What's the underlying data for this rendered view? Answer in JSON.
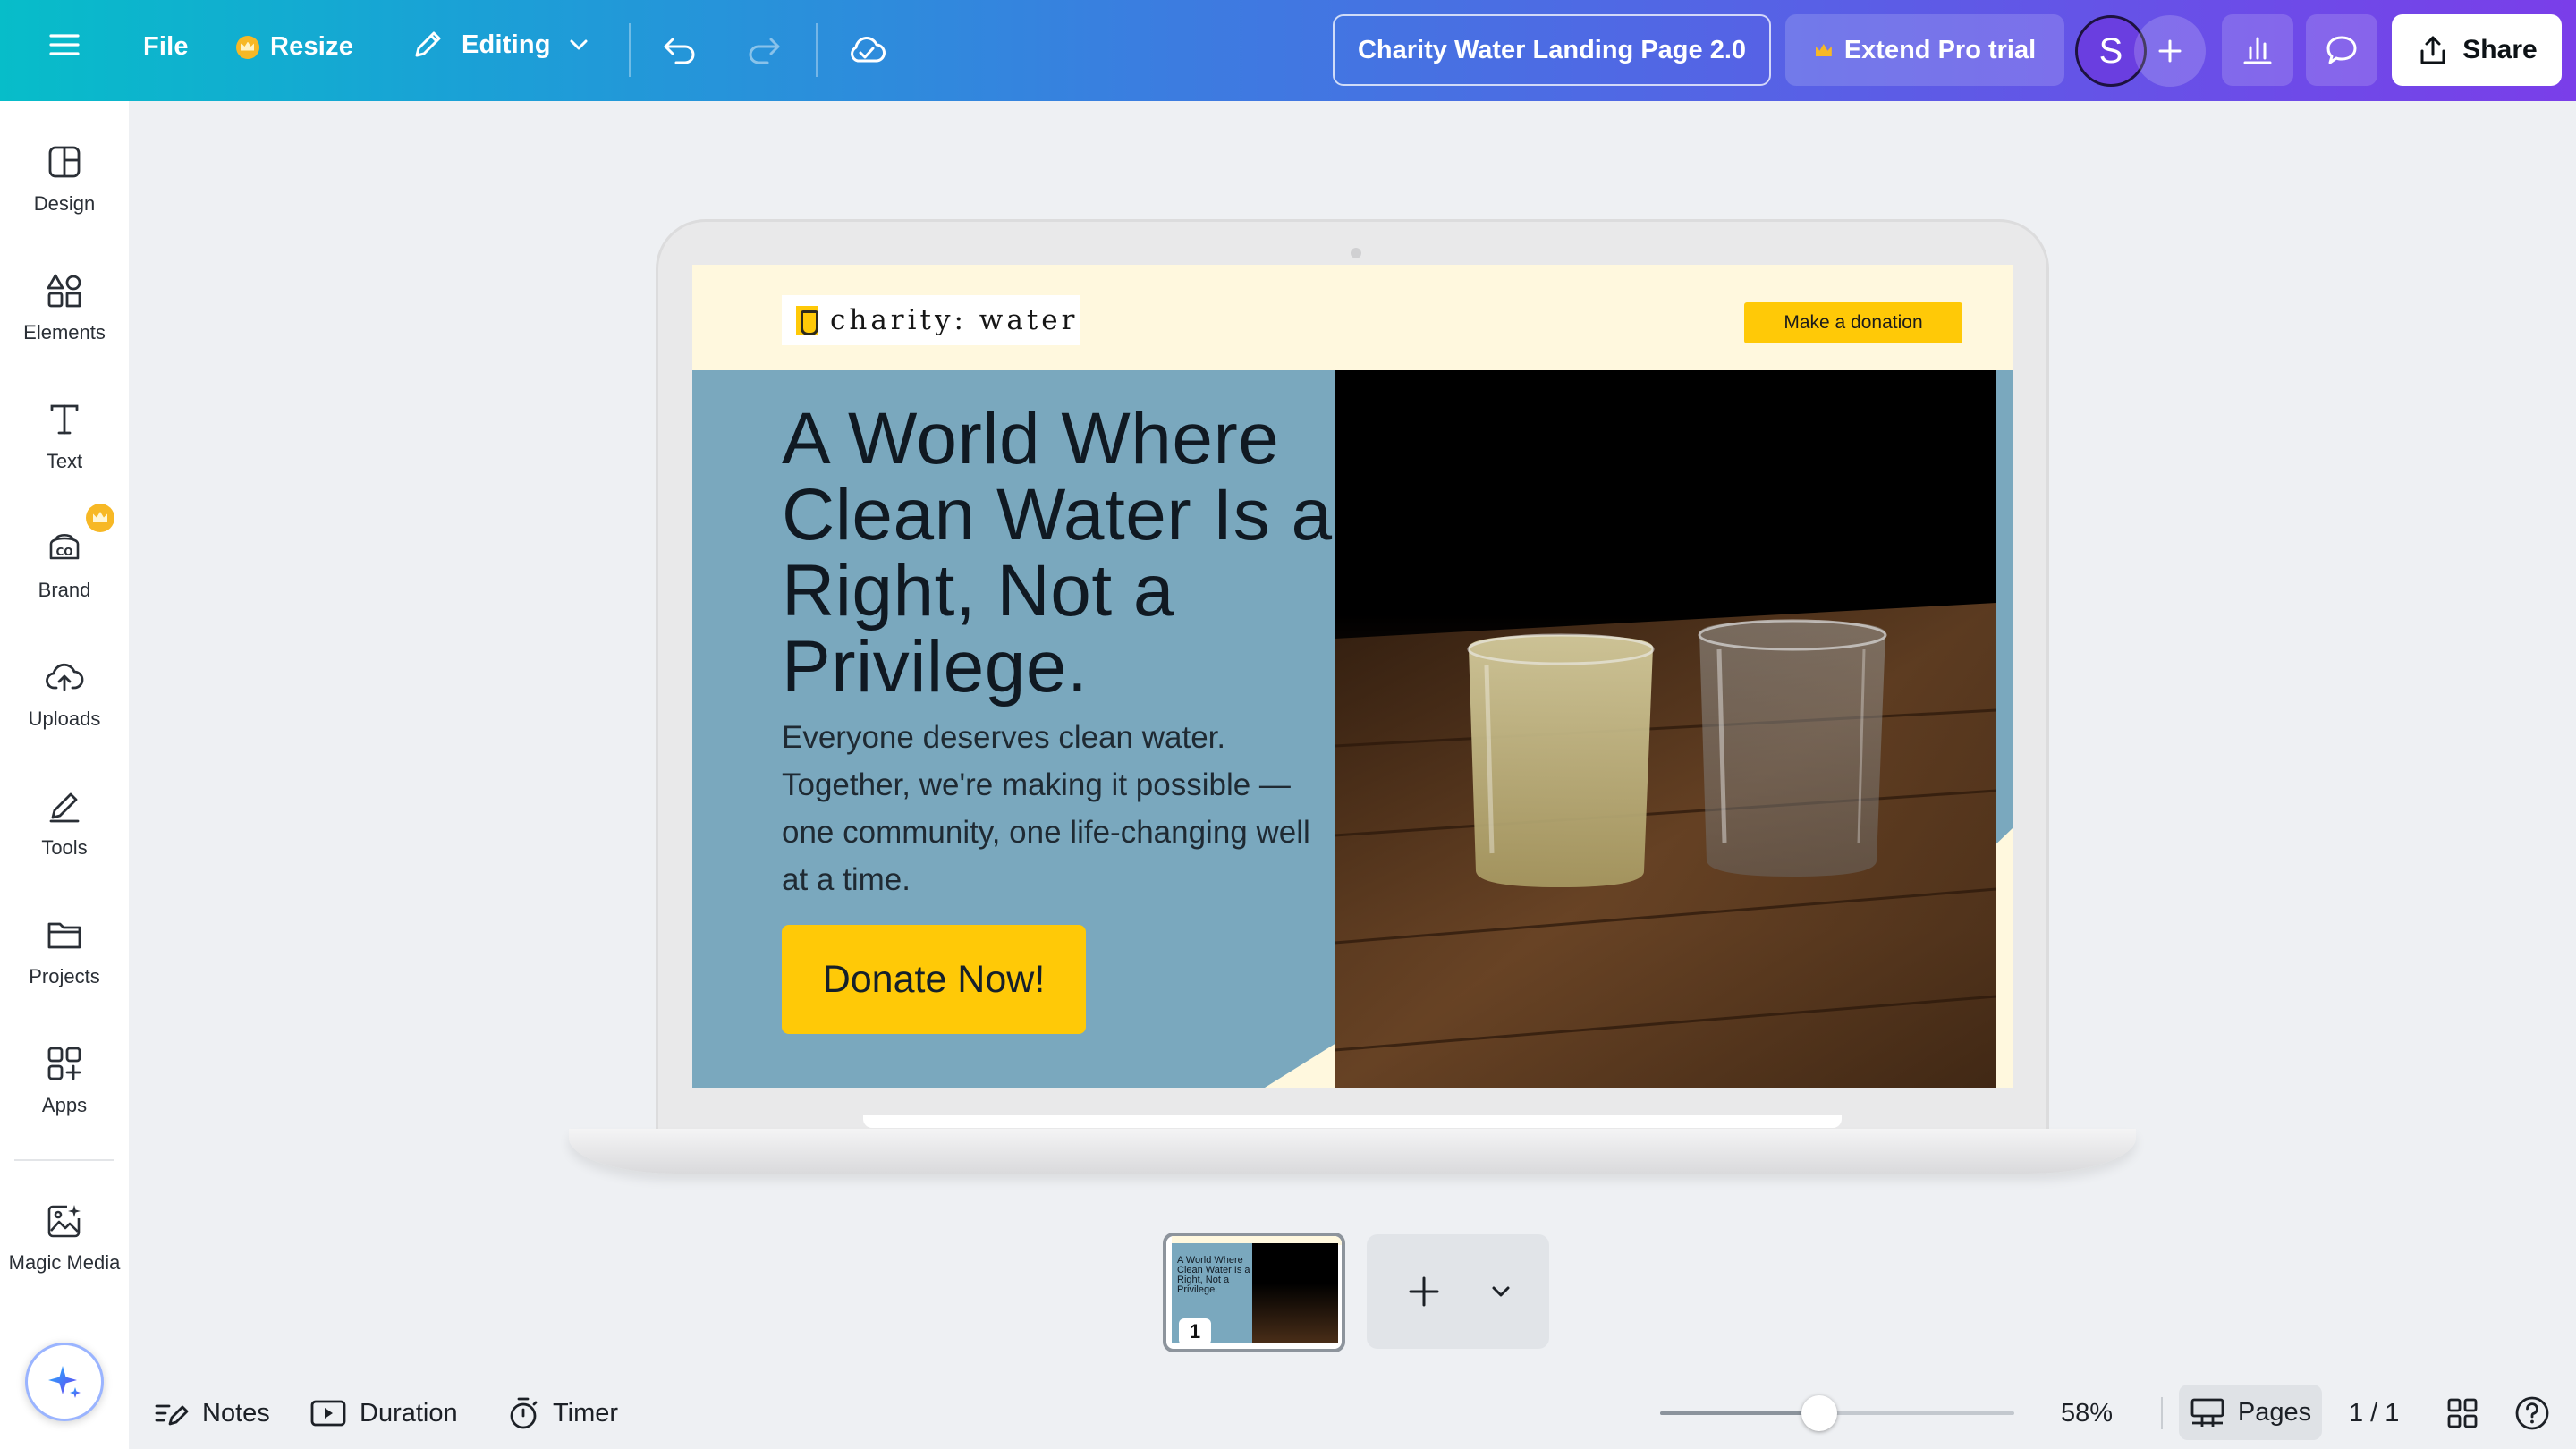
{
  "topbar": {
    "file_label": "File",
    "resize_label": "Resize",
    "mode_label": "Editing",
    "doc_title": "Charity Water Landing Page 2.0",
    "trial_label": "Extend Pro trial",
    "avatar_initial": "S",
    "share_label": "Share"
  },
  "sidebar": {
    "items": [
      {
        "label": "Design",
        "icon": "design-icon"
      },
      {
        "label": "Elements",
        "icon": "elements-icon"
      },
      {
        "label": "Text",
        "icon": "text-icon"
      },
      {
        "label": "Brand",
        "icon": "brand-icon"
      },
      {
        "label": "Uploads",
        "icon": "uploads-icon"
      },
      {
        "label": "Tools",
        "icon": "tools-icon"
      },
      {
        "label": "Projects",
        "icon": "projects-icon"
      },
      {
        "label": "Apps",
        "icon": "apps-icon"
      },
      {
        "label": "Magic Media",
        "icon": "magic-media-icon"
      }
    ]
  },
  "design": {
    "logo_text": "charity: water",
    "header_button": "Make a donation",
    "headline": "A World Where Clean Water Is a Right, Not a Privilege.",
    "subcopy": "Everyone deserves clean water. Together, we're making it possible — one community, one life-changing well at a time.",
    "cta_button": "Donate Now!",
    "colors": {
      "accent": "#ffc907",
      "hero_bg": "#7aa8be",
      "page_bg": "#fff8de"
    }
  },
  "pages": {
    "thumb_number": "1",
    "thumb_text": "A World Where Clean Water Is a Right, Not a Privilege."
  },
  "bottombar": {
    "notes_label": "Notes",
    "duration_label": "Duration",
    "timer_label": "Timer",
    "zoom_value": 0.45,
    "zoom_label": "58%",
    "pages_label": "Pages",
    "page_count": "1 / 1"
  }
}
